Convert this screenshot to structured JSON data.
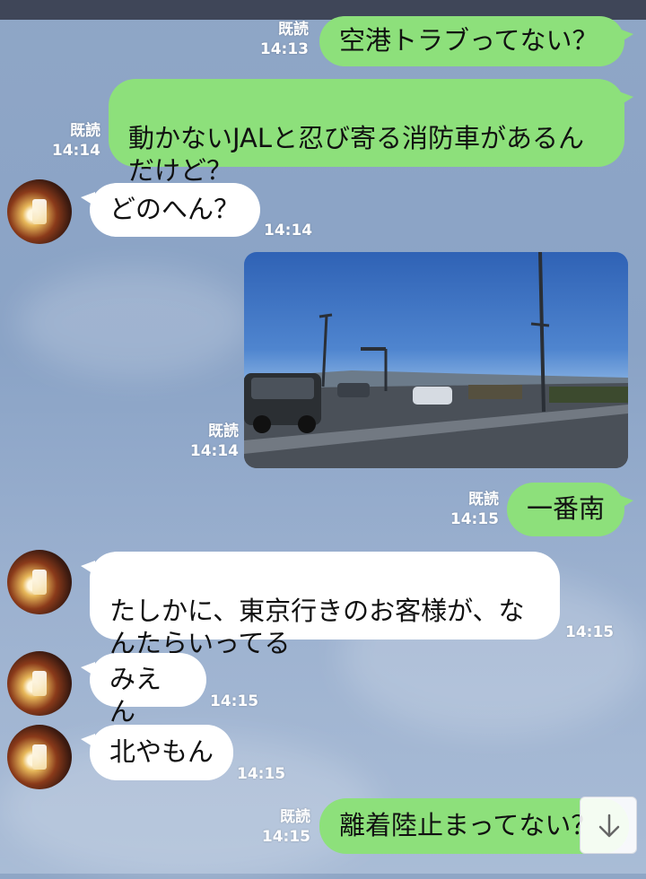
{
  "read_label": "既読",
  "messages": [
    {
      "side": "me",
      "text": "空港トラブってない？",
      "time": "14:13",
      "read": true
    },
    {
      "side": "me",
      "text": "動かないJALと忍び寄る消防車があるん\nだけど？",
      "time": "14:14",
      "read": true
    },
    {
      "side": "them",
      "text": "どのへん？",
      "time": "14:14"
    },
    {
      "side": "me",
      "type": "image",
      "time": "14:14",
      "read": true
    },
    {
      "side": "me",
      "text": "一番南",
      "time": "14:15",
      "read": true
    },
    {
      "side": "them",
      "text": "たしかに、東京行きのお客様が、な\nんたらいってる",
      "time": "14:15"
    },
    {
      "side": "them",
      "text": "みえん",
      "time": "14:15"
    },
    {
      "side": "them",
      "text": "北やもん",
      "time": "14:15"
    },
    {
      "side": "me",
      "text": "離着陸止まってない？",
      "time": "14:15",
      "read": true
    }
  ],
  "icons": {
    "scroll_down": "arrow-down-icon",
    "avatar": "contact-avatar"
  },
  "colors": {
    "my_bubble": "#8de07b",
    "their_bubble": "#ffffff",
    "background": "#8fa6c6"
  }
}
